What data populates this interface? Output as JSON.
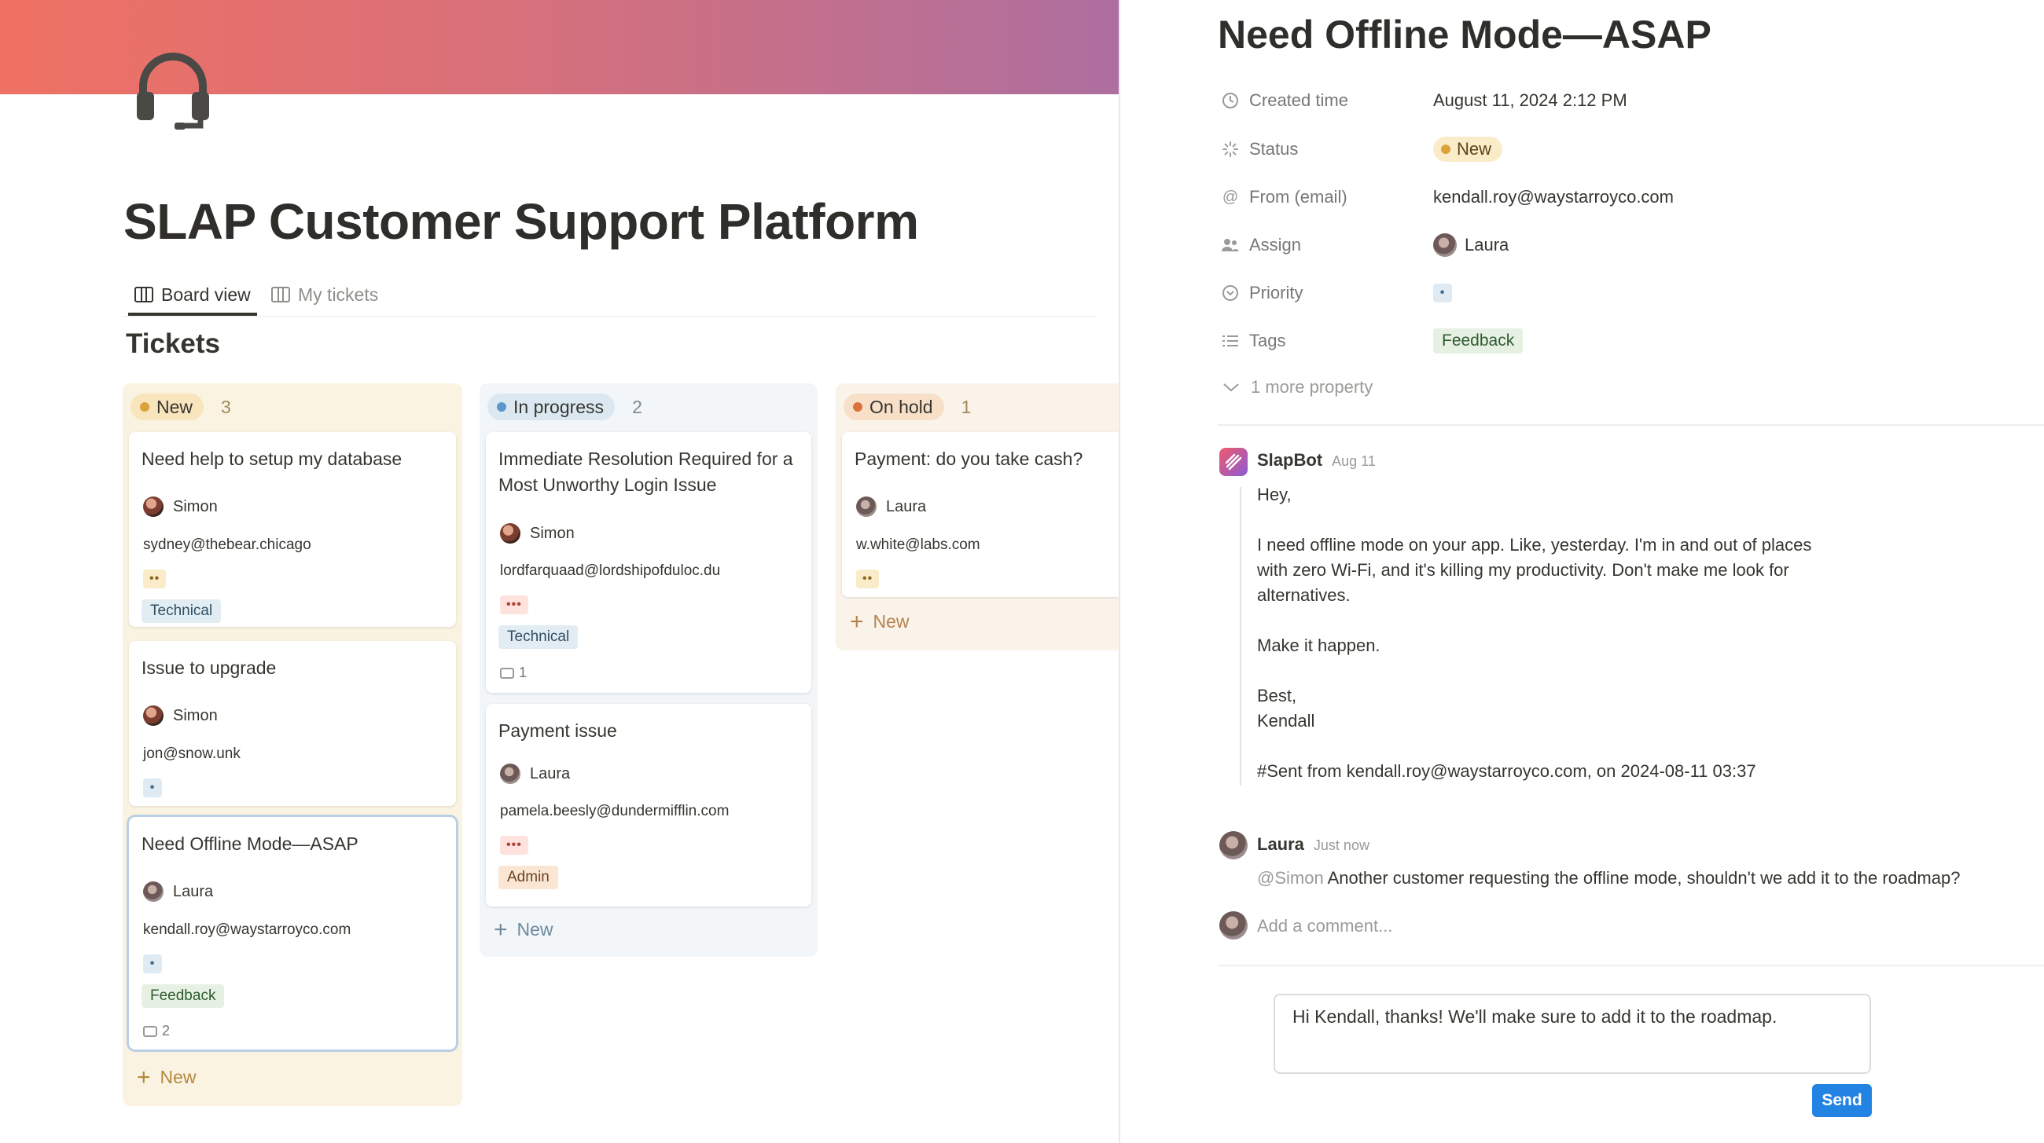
{
  "page": {
    "title": "SLAP Customer Support Platform",
    "section_title": "Tickets",
    "tabs": [
      {
        "label": "Board view",
        "active": true
      },
      {
        "label": "My tickets",
        "active": false
      }
    ]
  },
  "columns": [
    {
      "status": "New",
      "count": "3",
      "dot_color": "#d9a23b",
      "add_label": "New",
      "cards": [
        {
          "title": "Need help to setup my database",
          "assignee": "Simon",
          "email": "sydney@thebear.chicago",
          "priority": "••",
          "tag": "Technical"
        },
        {
          "title": "Issue to upgrade",
          "assignee": "Simon",
          "email": "jon@snow.unk",
          "priority": "•"
        },
        {
          "title": "Need Offline Mode—ASAP",
          "assignee": "Laura",
          "email": "kendall.roy@waystarroyco.com",
          "priority": "•",
          "tag": "Feedback",
          "comments": "2"
        }
      ]
    },
    {
      "status": "In progress",
      "count": "2",
      "dot_color": "#5b97c9",
      "add_label": "New",
      "cards": [
        {
          "title": "Immediate Resolution Required for a Most Unworthy Login Issue",
          "assignee": "Simon",
          "email": "lordfarquaad@lordshipofduloc.du",
          "priority": "•••",
          "tag": "Technical",
          "comments": "1"
        },
        {
          "title": "Payment issue",
          "assignee": "Laura",
          "email": "pamela.beesly@dundermifflin.com",
          "priority": "•••",
          "tag": "Admin"
        }
      ]
    },
    {
      "status": "On hold",
      "count": "1",
      "dot_color": "#d9733b",
      "add_label": "New",
      "cards": [
        {
          "title": "Payment: do you take cash?",
          "assignee": "Laura",
          "email": "w.white@labs.com",
          "priority": "••"
        }
      ]
    }
  ],
  "detail": {
    "title": "Need Offline Mode—ASAP",
    "properties": [
      {
        "name": "Created time",
        "value": "August 11, 2024 2:12 PM",
        "icon": "clock-icon"
      },
      {
        "name": "Status",
        "value": "New",
        "icon": "status-icon"
      },
      {
        "name": "From (email)",
        "value": "kendall.roy@waystarroyco.com",
        "icon": "at-icon"
      },
      {
        "name": "Assign",
        "value": "Laura",
        "icon": "people-icon"
      },
      {
        "name": "Priority",
        "value": "•",
        "icon": "priority-icon"
      },
      {
        "name": "Tags",
        "value": "Feedback",
        "icon": "list-icon"
      }
    ],
    "more_property": "1 more property",
    "messages": [
      {
        "author": "SlapBot",
        "time": "Aug 11",
        "lines": [
          "Hey,",
          "",
          "I need offline mode on your app. Like, yesterday. I'm in and out of places",
          "with zero Wi-Fi, and it's killing my productivity. Don't make me look for",
          "alternatives.",
          "",
          "Make it happen.",
          "",
          "Best,",
          "Kendall",
          "",
          "#Sent from kendall.roy@waystarroyco.com, on 2024-08-11 03:37"
        ]
      },
      {
        "author": "Laura",
        "time": "Just now",
        "mention": "@Simon",
        "text": "Another customer requesting the offline mode, shouldn't we add it to the roadmap?"
      }
    ],
    "comment_placeholder": "Add a comment...",
    "reply_text": "Hi Kendall, thanks! We'll make sure to add it to the roadmap.",
    "send_label": "Send"
  }
}
